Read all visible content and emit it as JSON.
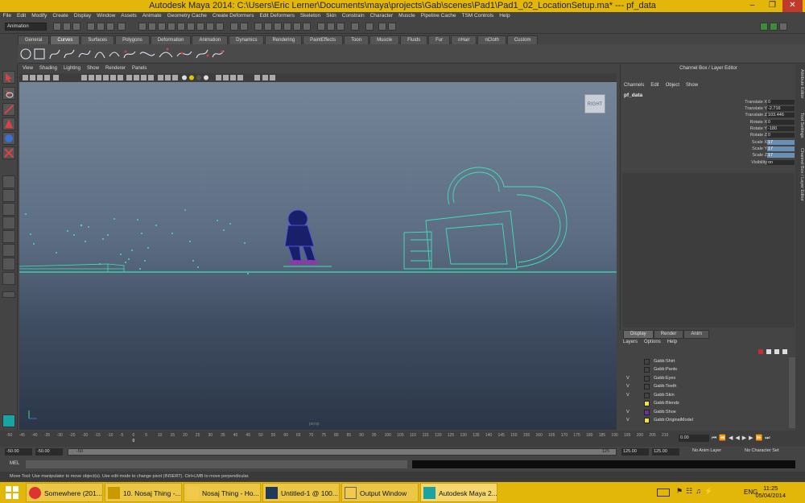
{
  "window": {
    "title": "Autodesk Maya 2014: C:\\Users\\Eric Lerner\\Documents\\maya\\projects\\Gab\\scenes\\Pad1\\Pad1_02_LocationSetup.ma*   ---   pf_data"
  },
  "menubar": [
    "File",
    "Edit",
    "Modify",
    "Create",
    "Display",
    "Window",
    "Assets",
    "Animate",
    "Geometry Cache",
    "Create Deformers",
    "Edit Deformers",
    "Skeleton",
    "Skin",
    "Constrain",
    "Character",
    "Muscle",
    "Pipeline Cache",
    "TSM Controls",
    "Help"
  ],
  "statusline": {
    "mode": "Animation"
  },
  "shelf_tabs": [
    "General",
    "Curves",
    "Surfaces",
    "Polygons",
    "Deformation",
    "Animation",
    "Dynamics",
    "Rendering",
    "PaintEffects",
    "Toon",
    "Muscle",
    "Fluids",
    "Fur",
    "nHair",
    "nCloth",
    "Custom"
  ],
  "shelf_active": "Curves",
  "panel_menu": [
    "View",
    "Shading",
    "Lighting",
    "Show",
    "Renderer",
    "Panels"
  ],
  "viewport": {
    "viewcube_label": "RIGHT",
    "camera_label": "persp"
  },
  "channel_box": {
    "title": "Channel Box / Layer Editor",
    "menu": [
      "Channels",
      "Edit",
      "Object",
      "Show"
    ],
    "node": "pf_data",
    "channels": [
      {
        "name": "Translate X",
        "value": "0"
      },
      {
        "name": "Translate Y",
        "value": "-2.716"
      },
      {
        "name": "Translate Z",
        "value": "103.446"
      },
      {
        "name": "Rotate X",
        "value": "0"
      },
      {
        "name": "Rotate Y",
        "value": "-180"
      },
      {
        "name": "Rotate Z",
        "value": "0"
      },
      {
        "name": "Scale X",
        "value": "17"
      },
      {
        "name": "Scale Y",
        "value": "17"
      },
      {
        "name": "Scale Z",
        "value": "17"
      },
      {
        "name": "Visibility",
        "value": "on"
      }
    ]
  },
  "side_tabs": [
    "Attribute Editor",
    "Tool Settings",
    "Channel Box / Layer Editor"
  ],
  "layer_editor": {
    "tabs": [
      "Display",
      "Render",
      "Anim"
    ],
    "menu": [
      "Layers",
      "Options",
      "Help"
    ],
    "layers": [
      {
        "name": "Gabb:Shirt",
        "visible": "",
        "color": "#444444"
      },
      {
        "name": "Gabb:Pants",
        "visible": "",
        "color": "#444444"
      },
      {
        "name": "Gabb:Eyes",
        "visible": "V",
        "color": "#444444"
      },
      {
        "name": "Gabb:Teeth",
        "visible": "V",
        "color": "#444444"
      },
      {
        "name": "Gabb:Skin",
        "visible": "V",
        "color": "#444444"
      },
      {
        "name": "Gabb:Blendz",
        "visible": "",
        "color": "#f0e040"
      },
      {
        "name": "Gabb:Shoe",
        "visible": "V",
        "color": "#7030a0"
      },
      {
        "name": "Gabb:OriginalModel",
        "visible": "V",
        "color": "#f0e040"
      }
    ]
  },
  "timeslider": {
    "ticks": [
      "-50",
      "-45",
      "-40",
      "-35",
      "-30",
      "-25",
      "-20",
      "-15",
      "-10",
      "-5",
      "0",
      "5",
      "10",
      "15",
      "20",
      "25",
      "30",
      "35",
      "40",
      "45",
      "50",
      "55",
      "60",
      "65",
      "70",
      "75",
      "80",
      "85",
      "90",
      "95",
      "100",
      "105",
      "110",
      "115",
      "120",
      "125",
      "130",
      "135",
      "140",
      "145",
      "150",
      "155",
      "160",
      "165",
      "170",
      "175",
      "180",
      "185",
      "190",
      "195",
      "200",
      "205",
      "210"
    ],
    "current_frame": "0",
    "current_field": "0.00"
  },
  "range_slider": {
    "start": "-50.00",
    "inner_start": "-50.00",
    "range_label_left": "-50",
    "range_label_right": "125",
    "inner_end": "125.00",
    "end": "125.00",
    "anim_layer": "No Anim Layer",
    "character_set": "No Character Set"
  },
  "command_line": {
    "label": "MEL"
  },
  "help_line": "Move Tool: Use manipulator to move object(s). Use edit mode to change pivot (INSERT). Ctrl+LMB to move perpendicular.",
  "taskbar": {
    "items": [
      {
        "label": "Somewhere (201...",
        "icon": "chrome-icon",
        "color": "#d33"
      },
      {
        "label": "10. Nosaj Thing -...",
        "icon": "winamp-icon",
        "color": "#e3b60a"
      },
      {
        "label": "Nosaj Thing - Ho...",
        "icon": "folder-icon",
        "color": "#f2c94c"
      },
      {
        "label": "Untitled-1 @ 100...",
        "icon": "photoshop-icon",
        "color": "#1f3a5a"
      },
      {
        "label": "Output Window",
        "icon": "window-icon",
        "color": "#f2c94c"
      },
      {
        "label": "Autodesk Maya 2...",
        "icon": "maya-icon",
        "color": "#1aa3a3"
      }
    ],
    "language": "ENG",
    "time": "11:25",
    "date": "05/04/2014"
  }
}
